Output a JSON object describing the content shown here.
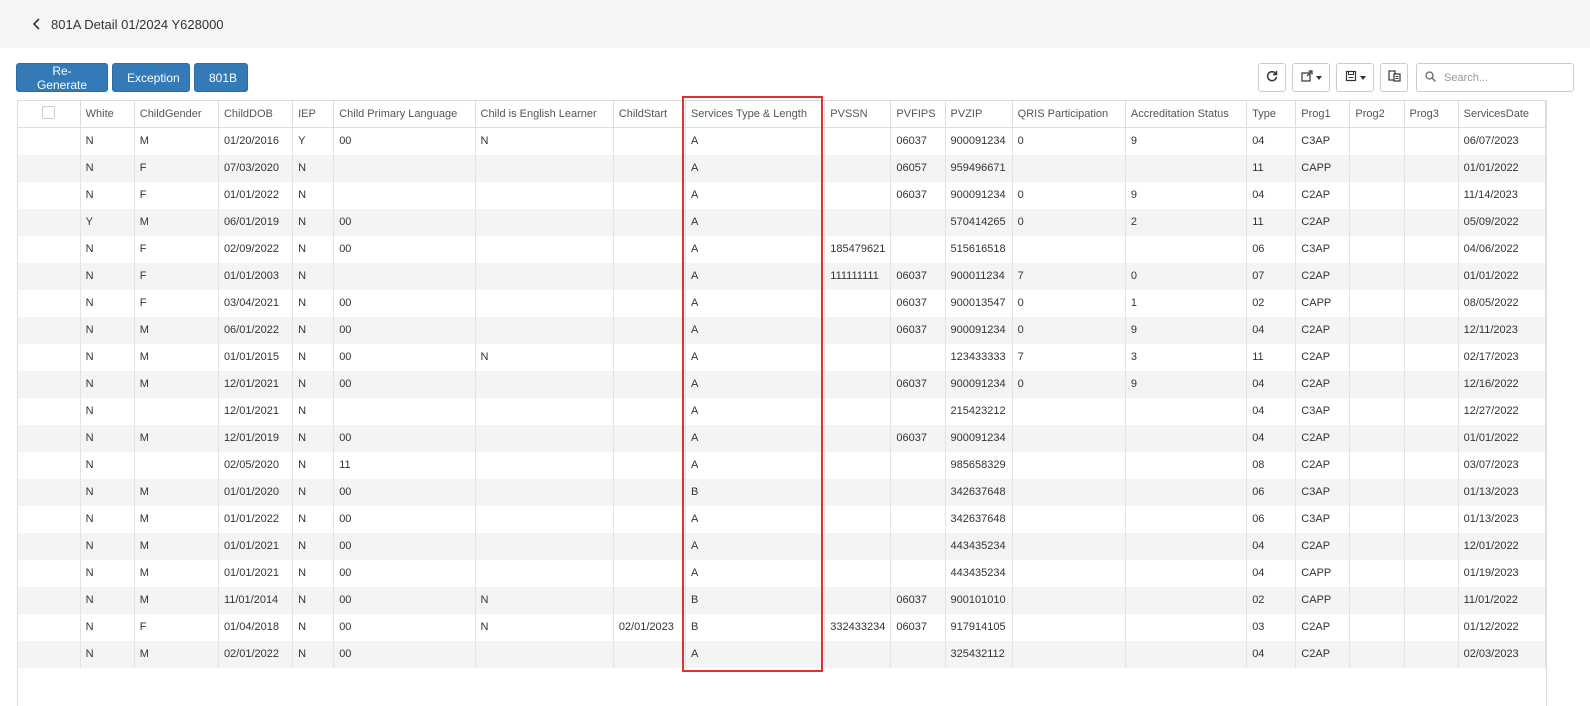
{
  "header": {
    "title": "801A Detail 01/2024 Y628000"
  },
  "toolbar": {
    "regenerate_label": "Re-Generate",
    "exception_label": "Exception",
    "b801_label": "801B",
    "search_placeholder": "Search..."
  },
  "icons": {
    "back": "chevron-left-icon",
    "refresh": "refresh-icon",
    "export": "export-icon",
    "save": "save-icon",
    "columns": "columns-icon",
    "search": "search-icon"
  },
  "colors": {
    "primary": "#337ab7",
    "highlight": "#e03030"
  },
  "table": {
    "columns": [
      "White",
      "ChildGender",
      "ChildDOB",
      "IEP",
      "Child Primary Language",
      "Child is English Learner",
      "ChildStart",
      "Services Type & Length",
      "PVSSN",
      "PVFIPS",
      "PVZIP",
      "QRIS Participation",
      "Accreditation Status",
      "Type",
      "Prog1",
      "Prog2",
      "Prog3",
      "ServicesDate"
    ],
    "rows": [
      [
        "N",
        "M",
        "01/20/2016",
        "Y",
        "00",
        "N",
        "",
        "A",
        "",
        "06037",
        "900091234",
        "0",
        "9",
        "04",
        "C3AP",
        "",
        "",
        "06/07/2023"
      ],
      [
        "N",
        "F",
        "07/03/2020",
        "N",
        "",
        "",
        "",
        "A",
        "",
        "06057",
        "959496671",
        "",
        "",
        "11",
        "CAPP",
        "",
        "",
        "01/01/2022"
      ],
      [
        "N",
        "F",
        "01/01/2022",
        "N",
        "",
        "",
        "",
        "A",
        "",
        "06037",
        "900091234",
        "0",
        "9",
        "04",
        "C2AP",
        "",
        "",
        "11/14/2023"
      ],
      [
        "Y",
        "M",
        "06/01/2019",
        "N",
        "00",
        "",
        "",
        "A",
        "",
        "",
        "570414265",
        "0",
        "2",
        "11",
        "C2AP",
        "",
        "",
        "05/09/2022"
      ],
      [
        "N",
        "F",
        "02/09/2022",
        "N",
        "00",
        "",
        "",
        "A",
        "185479621",
        "",
        "515616518",
        "",
        "",
        "06",
        "C3AP",
        "",
        "",
        "04/06/2022"
      ],
      [
        "N",
        "F",
        "01/01/2003",
        "N",
        "",
        "",
        "",
        "A",
        "111111111",
        "06037",
        "900011234",
        "7",
        "0",
        "07",
        "C2AP",
        "",
        "",
        "01/01/2022"
      ],
      [
        "N",
        "F",
        "03/04/2021",
        "N",
        "00",
        "",
        "",
        "A",
        "",
        "06037",
        "900013547",
        "0",
        "1",
        "02",
        "CAPP",
        "",
        "",
        "08/05/2022"
      ],
      [
        "N",
        "M",
        "06/01/2022",
        "N",
        "00",
        "",
        "",
        "A",
        "",
        "06037",
        "900091234",
        "0",
        "9",
        "04",
        "C2AP",
        "",
        "",
        "12/11/2023"
      ],
      [
        "N",
        "M",
        "01/01/2015",
        "N",
        "00",
        "N",
        "",
        "A",
        "",
        "",
        "123433333",
        "7",
        "3",
        "11",
        "C2AP",
        "",
        "",
        "02/17/2023"
      ],
      [
        "N",
        "M",
        "12/01/2021",
        "N",
        "00",
        "",
        "",
        "A",
        "",
        "06037",
        "900091234",
        "0",
        "9",
        "04",
        "C2AP",
        "",
        "",
        "12/16/2022"
      ],
      [
        "N",
        "",
        "12/01/2021",
        "N",
        "",
        "",
        "",
        "A",
        "",
        "",
        "215423212",
        "",
        "",
        "04",
        "C3AP",
        "",
        "",
        "12/27/2022"
      ],
      [
        "N",
        "M",
        "12/01/2019",
        "N",
        "00",
        "",
        "",
        "A",
        "",
        "06037",
        "900091234",
        "",
        "",
        "04",
        "C2AP",
        "",
        "",
        "01/01/2022"
      ],
      [
        "N",
        "",
        "02/05/2020",
        "N",
        "11",
        "",
        "",
        "A",
        "",
        "",
        "985658329",
        "",
        "",
        "08",
        "C2AP",
        "",
        "",
        "03/07/2023"
      ],
      [
        "N",
        "M",
        "01/01/2020",
        "N",
        "00",
        "",
        "",
        "B",
        "",
        "",
        "342637648",
        "",
        "",
        "06",
        "C3AP",
        "",
        "",
        "01/13/2023"
      ],
      [
        "N",
        "M",
        "01/01/2022",
        "N",
        "00",
        "",
        "",
        "A",
        "",
        "",
        "342637648",
        "",
        "",
        "06",
        "C3AP",
        "",
        "",
        "01/13/2023"
      ],
      [
        "N",
        "M",
        "01/01/2021",
        "N",
        "00",
        "",
        "",
        "A",
        "",
        "",
        "443435234",
        "",
        "",
        "04",
        "C2AP",
        "",
        "",
        "12/01/2022"
      ],
      [
        "N",
        "M",
        "01/01/2021",
        "N",
        "00",
        "",
        "",
        "A",
        "",
        "",
        "443435234",
        "",
        "",
        "04",
        "CAPP",
        "",
        "",
        "01/19/2023"
      ],
      [
        "N",
        "M",
        "11/01/2014",
        "N",
        "00",
        "N",
        "",
        "B",
        "",
        "06037",
        "900101010",
        "",
        "",
        "02",
        "CAPP",
        "",
        "",
        "11/01/2022"
      ],
      [
        "N",
        "F",
        "01/04/2018",
        "N",
        "00",
        "N",
        "02/01/2023",
        "B",
        "332433234",
        "06037",
        "917914105",
        "",
        "",
        "03",
        "C2AP",
        "",
        "",
        "01/12/2022"
      ],
      [
        "N",
        "M",
        "02/01/2022",
        "N",
        "00",
        "",
        "",
        "A",
        "",
        "",
        "325432112",
        "",
        "",
        "04",
        "C2AP",
        "",
        "",
        "02/03/2023"
      ]
    ]
  }
}
